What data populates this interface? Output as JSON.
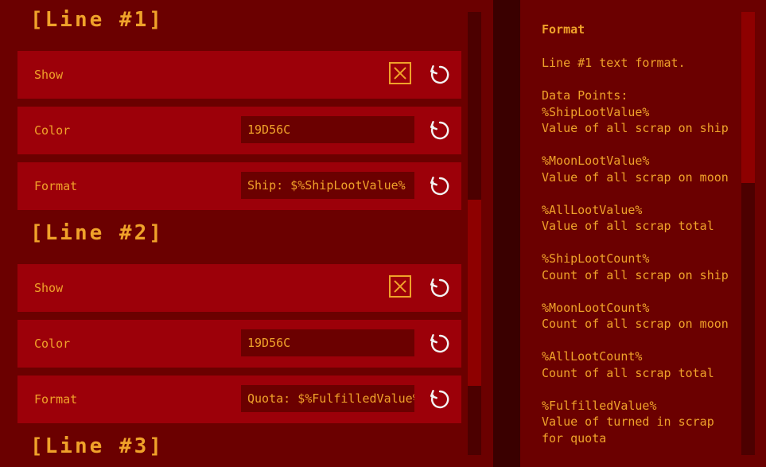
{
  "sections": [
    {
      "title": "[Line #1]",
      "show_label": "Show",
      "show_checked": true,
      "color_label": "Color",
      "color_value": "19D56C",
      "format_label": "Format",
      "format_value": "Ship: $%ShipLootValue%"
    },
    {
      "title": "[Line #2]",
      "show_label": "Show",
      "show_checked": true,
      "color_label": "Color",
      "color_value": "19D56C",
      "format_label": "Format",
      "format_value": "Quota: $%FulfilledValue%"
    },
    {
      "title": "[Line #3]"
    }
  ],
  "help": {
    "title": "Format",
    "description": "Line #1 text format.",
    "data_points_label": "Data Points:",
    "data_points": [
      {
        "token": "%ShipLootValue%",
        "desc": "Value of all scrap on ship"
      },
      {
        "token": "%MoonLootValue%",
        "desc": "Value of all scrap on moon"
      },
      {
        "token": "%AllLootValue%",
        "desc": "Value of all scrap total"
      },
      {
        "token": "%ShipLootCount%",
        "desc": "Count of all scrap on ship"
      },
      {
        "token": "%MoonLootCount%",
        "desc": "Count of all scrap on moon"
      },
      {
        "token": "%AllLootCount%",
        "desc": "Count of all scrap total"
      },
      {
        "token": "%FulfilledValue%",
        "desc": "Value of turned in scrap for quota"
      }
    ]
  },
  "colors": {
    "accent": "#f0a22a",
    "row_bg": "#9c0009",
    "panel_bg": "#6b0000"
  }
}
